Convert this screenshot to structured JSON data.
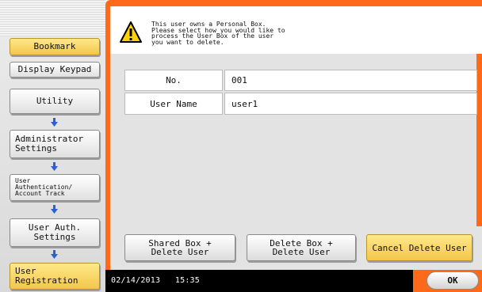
{
  "sidebar": {
    "bookmark": "Bookmark",
    "display_keypad": "Display Keypad",
    "utility": "Utility",
    "administrator_settings": "Administrator\nSettings",
    "user_auth_account_track": "User\nAuthentication/\nAccount Track",
    "user_auth_settings": "User Auth.\nSettings",
    "user_registration": "User\nRegistration"
  },
  "message": {
    "text": "This user owns a Personal Box.\nPlease select how you would like to\nprocess the User Box of the user\nyou want to delete.",
    "icon": "warning-icon"
  },
  "fields": [
    {
      "label": "No.",
      "value": "001"
    },
    {
      "label": "User Name",
      "value": "user1"
    }
  ],
  "actions": {
    "shared_box_delete": "Shared Box +\nDelete User",
    "delete_box_delete": "Delete Box +\nDelete User",
    "cancel_delete": "Cancel Delete User"
  },
  "status": {
    "date": "02/14/2013",
    "time": "15:35"
  },
  "ok_label": "OK",
  "colors": {
    "accent": "#ff6a1a",
    "highlight": "#f3c64a",
    "arrow": "#2a5fd6"
  }
}
